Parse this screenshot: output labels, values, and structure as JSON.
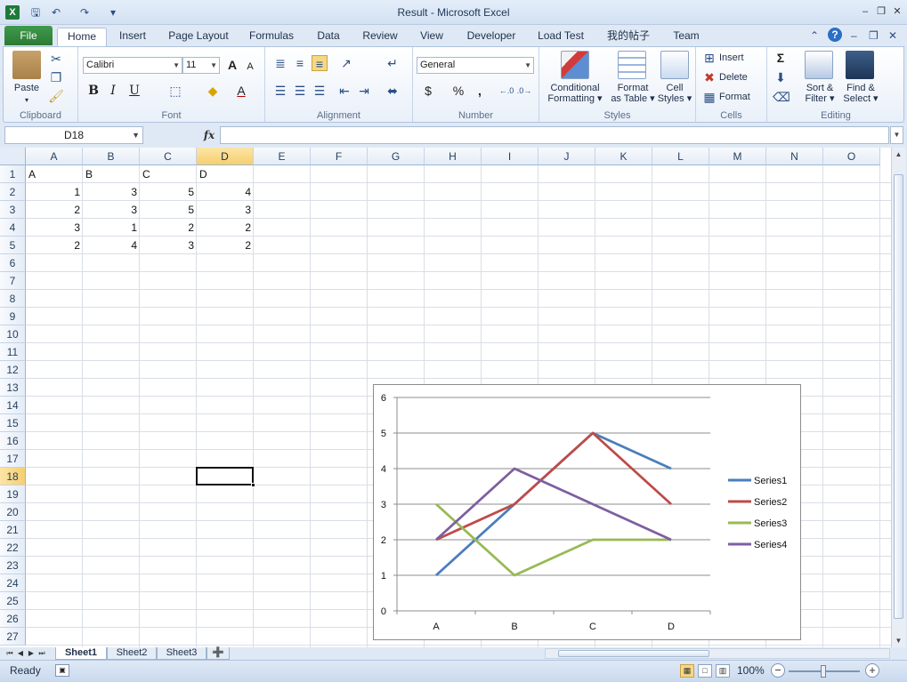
{
  "window": {
    "title": "Result  -  Microsoft Excel",
    "app_icon": "X",
    "qat": [
      "save-icon",
      "undo-icon",
      "redo-icon",
      "customize-icon"
    ]
  },
  "tabs": {
    "file": "File",
    "items": [
      "Home",
      "Insert",
      "Page Layout",
      "Formulas",
      "Data",
      "Review",
      "View",
      "Developer",
      "Load Test",
      "我的帖子",
      "Team"
    ],
    "active": "Home"
  },
  "ribbon": {
    "clipboard": {
      "label": "Clipboard",
      "paste": "Paste"
    },
    "font": {
      "label": "Font",
      "name": "Calibri",
      "size": "11",
      "bold": "B",
      "italic": "I",
      "underline": "U",
      "grow": "A",
      "shrink": "A",
      "font_color": "A"
    },
    "alignment": {
      "label": "Alignment"
    },
    "number": {
      "label": "Number",
      "format": "General",
      "currency": "$",
      "percent": "%",
      "comma": ","
    },
    "styles": {
      "label": "Styles",
      "conditional_1": "Conditional",
      "conditional_2": "Formatting",
      "format_table_1": "Format",
      "format_table_2": "as Table",
      "cell_styles_1": "Cell",
      "cell_styles_2": "Styles"
    },
    "cells": {
      "label": "Cells",
      "insert": "Insert",
      "delete": "Delete",
      "format": "Format"
    },
    "editing": {
      "label": "Editing",
      "sigma": "Σ",
      "sort_1": "Sort &",
      "sort_2": "Filter",
      "find_1": "Find &",
      "find_2": "Select"
    }
  },
  "formula_bar": {
    "name_box": "D18",
    "fx": "fx",
    "content": ""
  },
  "grid": {
    "columns": [
      "A",
      "B",
      "C",
      "D",
      "E",
      "F",
      "G",
      "H",
      "I",
      "J",
      "K",
      "L",
      "M",
      "N",
      "O"
    ],
    "rows": [
      "1",
      "2",
      "3",
      "4",
      "5",
      "6",
      "7",
      "8",
      "9",
      "10",
      "11",
      "12",
      "13",
      "14",
      "15",
      "16",
      "17",
      "18",
      "19",
      "20",
      "21",
      "22",
      "23",
      "24",
      "25",
      "26",
      "27"
    ],
    "selected_col": "D",
    "selected_row": "18",
    "cells": [
      [
        "A",
        "B",
        "C",
        "D"
      ],
      [
        "1",
        "3",
        "5",
        "4"
      ],
      [
        "2",
        "3",
        "5",
        "3"
      ],
      [
        "3",
        "1",
        "2",
        "2"
      ],
      [
        "2",
        "4",
        "3",
        "2"
      ]
    ]
  },
  "chart_data": {
    "type": "line",
    "categories": [
      "A",
      "B",
      "C",
      "D"
    ],
    "series": [
      {
        "name": "Series1",
        "values": [
          1,
          3,
          5,
          4
        ],
        "color": "#4a7ebb"
      },
      {
        "name": "Series2",
        "values": [
          2,
          3,
          5,
          3
        ],
        "color": "#be4b48"
      },
      {
        "name": "Series3",
        "values": [
          3,
          1,
          2,
          2
        ],
        "color": "#98b954"
      },
      {
        "name": "Series4",
        "values": [
          2,
          4,
          3,
          2
        ],
        "color": "#7d5fa0"
      }
    ],
    "ylim": [
      0,
      6
    ],
    "yticks": [
      "0",
      "1",
      "2",
      "3",
      "4",
      "5",
      "6"
    ],
    "grid": true,
    "legend": "right"
  },
  "sheet_tabs": [
    "Sheet1",
    "Sheet2",
    "Sheet3"
  ],
  "active_sheet": "Sheet1",
  "status": {
    "ready": "Ready",
    "zoom": "100%"
  }
}
